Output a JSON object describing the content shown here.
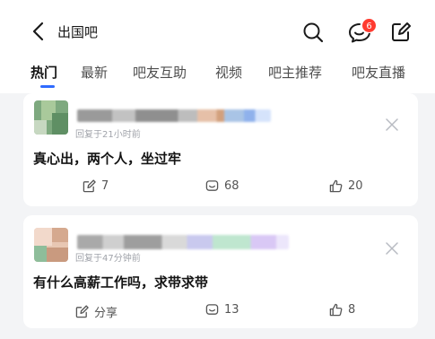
{
  "header": {
    "title": "出国吧",
    "message_badge": "6",
    "icons": [
      "back-arrow-icon",
      "search-icon",
      "message-icon",
      "edit-icon"
    ]
  },
  "tabs": [
    {
      "label": "热门",
      "active": true
    },
    {
      "label": "最新",
      "active": false
    },
    {
      "label": "吧友互助",
      "active": false
    },
    {
      "label": "视频",
      "active": false
    },
    {
      "label": "吧主推荐",
      "active": false
    },
    {
      "label": "吧友直播",
      "active": false
    }
  ],
  "posts": [
    {
      "meta": "回复于21小时前",
      "title": "真心出，两个人，坐过牢",
      "share": "7",
      "comments": "68",
      "likes": "20"
    },
    {
      "meta": "回复于47分钟前",
      "title": "有什么高薪工作吗，求带求带",
      "share": "分享",
      "comments": "13",
      "likes": "8"
    }
  ],
  "colors": {
    "accent": "#2f6bff",
    "badge": "#ff3b30",
    "background": "#f3f4f6"
  }
}
